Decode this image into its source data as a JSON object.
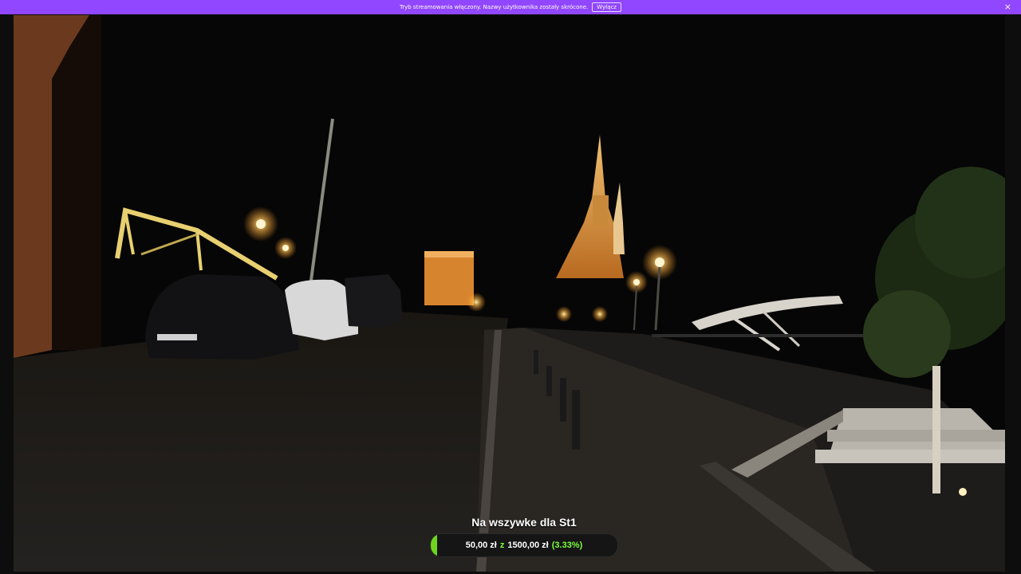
{
  "banner": {
    "message": "Tryb streamowania włączony. Nazwy użytkownika zostały skrócone.",
    "button_label": "Wyłącz",
    "close_glyph": "×",
    "color": "#9147ff"
  },
  "stream": {
    "goal": {
      "title": "Na wszywke dla St1",
      "current": "50,00 zł",
      "separator": "z",
      "target": "1500,00 zł",
      "percent_text": "(3.33%)",
      "progress_fraction": 0.0333,
      "accent": "#6fd41f"
    }
  }
}
